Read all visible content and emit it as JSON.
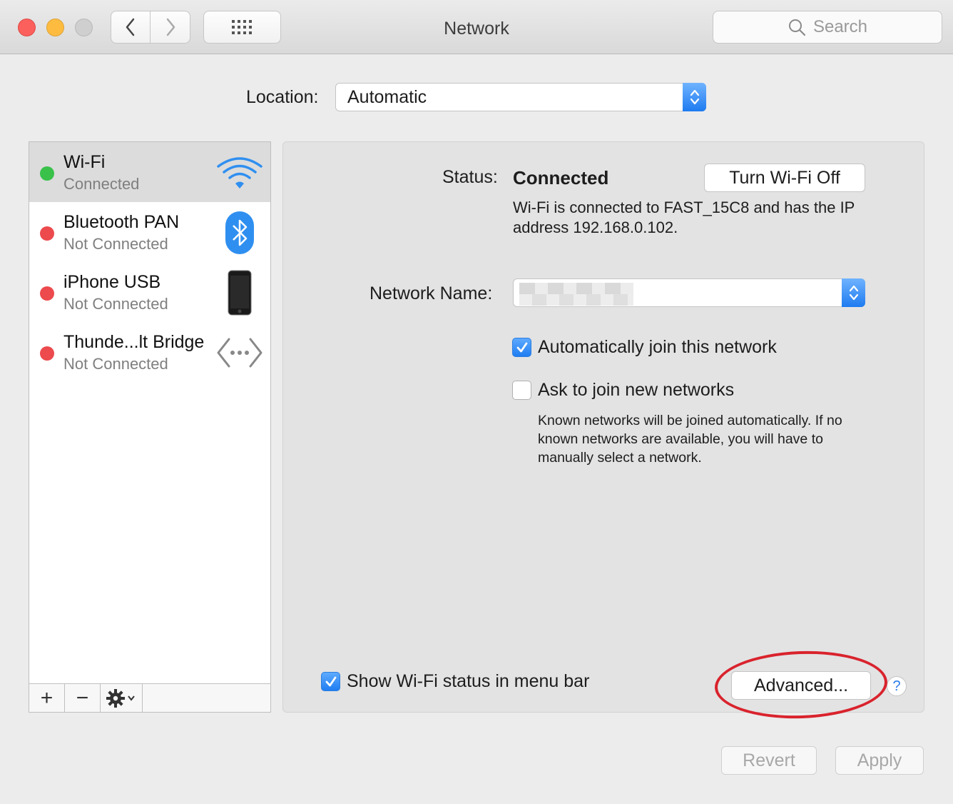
{
  "window": {
    "title": "Network",
    "search_placeholder": "Search"
  },
  "location": {
    "label": "Location:",
    "value": "Automatic"
  },
  "services": [
    {
      "name": "Wi-Fi",
      "status": "Connected",
      "icon": "wifi-icon",
      "state": "connected",
      "selected": true
    },
    {
      "name": "Bluetooth PAN",
      "status": "Not Connected",
      "icon": "bluetooth-icon",
      "state": "disconnected"
    },
    {
      "name": "iPhone USB",
      "status": "Not Connected",
      "icon": "iphone-icon",
      "state": "disconnected"
    },
    {
      "name": "Thunde...lt Bridge",
      "status": "Not Connected",
      "icon": "thunderbolt-bridge-icon",
      "state": "disconnected"
    }
  ],
  "sidebar_footer": {
    "add": "+",
    "remove": "−"
  },
  "detail": {
    "status_label": "Status:",
    "status_value": "Connected",
    "turn_off_label": "Turn Wi-Fi Off",
    "status_description": "Wi-Fi is connected to FAST_15C8 and has the IP address 192.168.0.102.",
    "network_name_label": "Network Name:",
    "auto_join_label": "Automatically join this network",
    "auto_join_checked": true,
    "ask_join_label": "Ask to join new networks",
    "ask_join_checked": false,
    "ask_join_help": "Known networks will be joined automatically. If no known networks are available, you will have to manually select a network.",
    "show_status_label": "Show Wi-Fi status in menu bar",
    "show_status_checked": true,
    "advanced_label": "Advanced...",
    "help_label": "?"
  },
  "footer": {
    "revert_label": "Revert",
    "apply_label": "Apply"
  },
  "colors": {
    "accent": "#1f7df2",
    "connected": "#39c14a",
    "disconnected": "#ec4a4d",
    "annotation": "#d9232d"
  }
}
